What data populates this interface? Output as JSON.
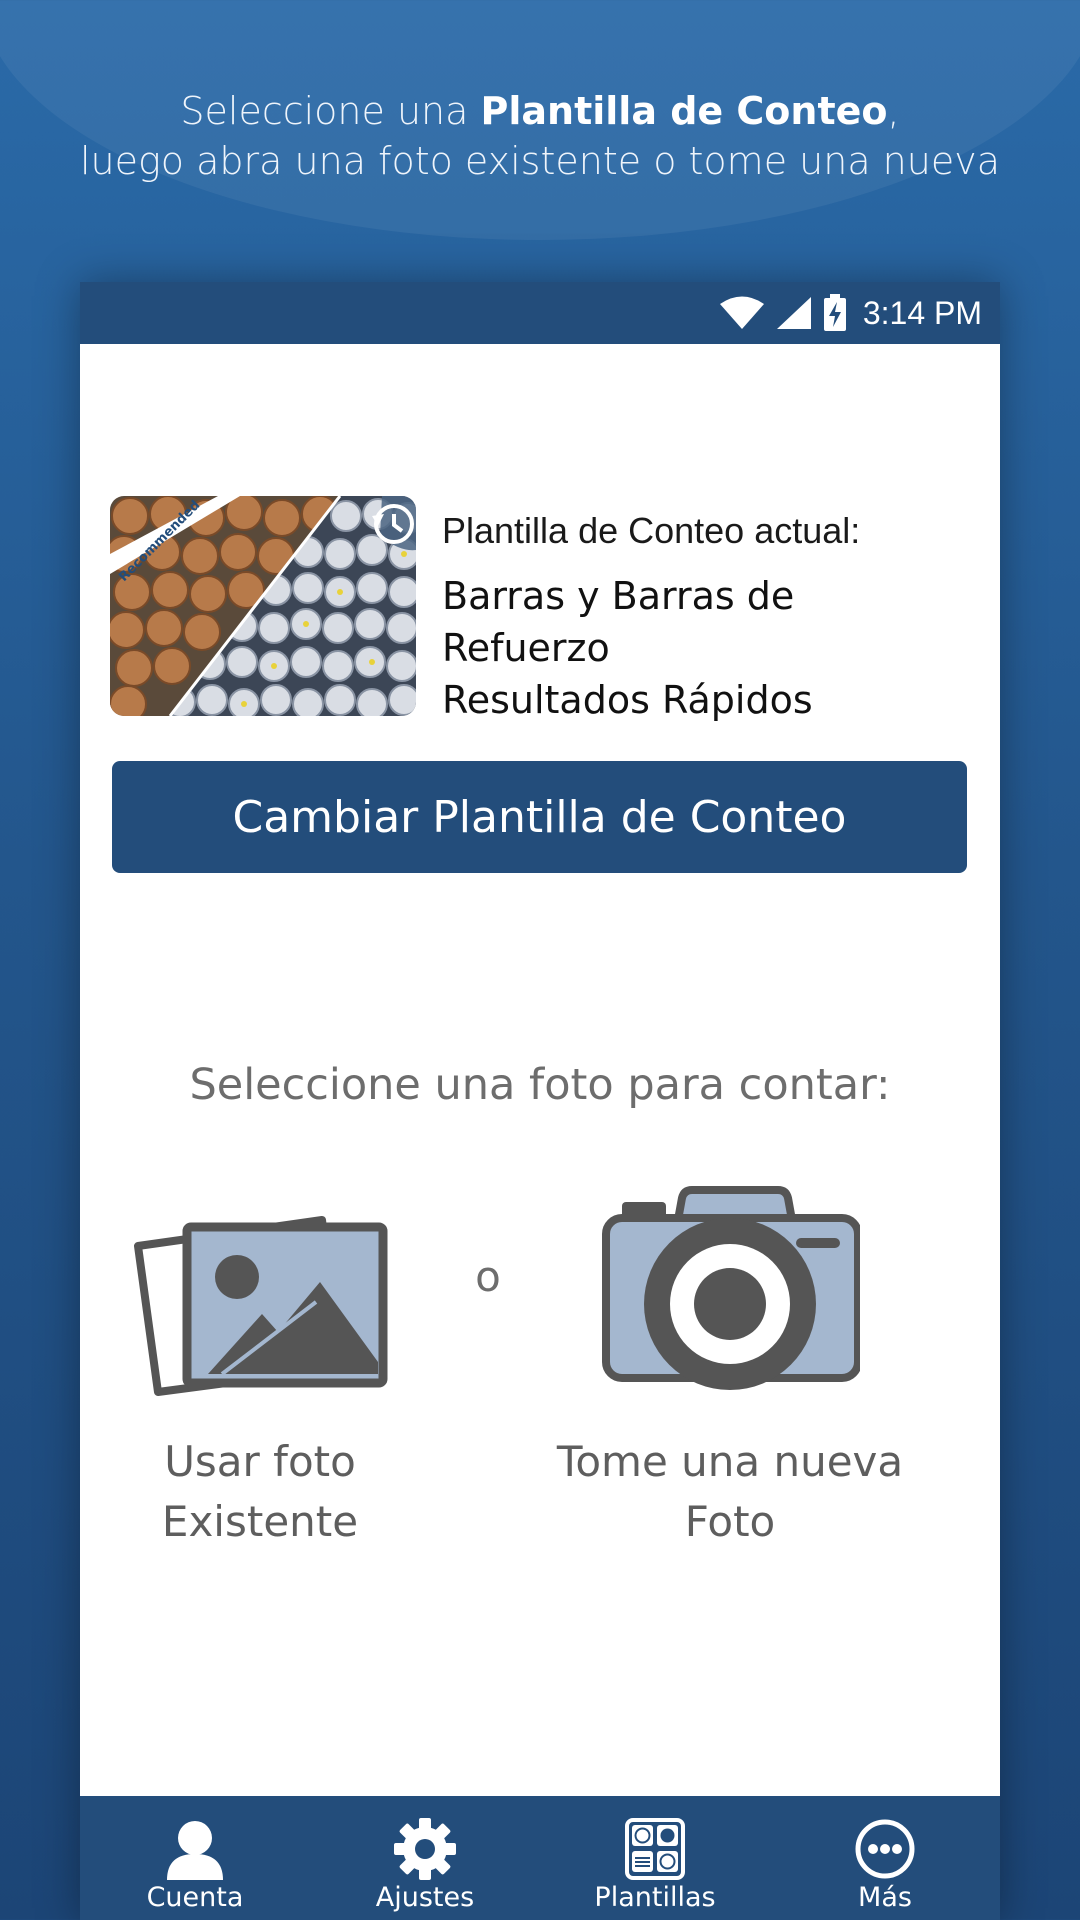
{
  "headline": {
    "prefix": "Seleccione una ",
    "bold": "Plantilla de Conteo",
    "suffix": ",",
    "line2": "luego abra una foto existente o tome una nueva"
  },
  "status_bar": {
    "time": "3:14 PM",
    "icons": [
      "wifi-icon",
      "signal-icon",
      "battery-charging-icon"
    ]
  },
  "template": {
    "badge": "Recommended",
    "heading": "Plantilla de Conteo actual:",
    "name_line1": "Barras y Barras de Refuerzo",
    "name_line2": "Resultados Rápidos"
  },
  "change_button": "Cambiar Plantilla de Conteo",
  "select_title": "Seleccione una foto para contar:",
  "options": {
    "existing_line1": "Usar foto",
    "existing_line2": "Existente",
    "or": "o",
    "new_line1": "Tome una nueva",
    "new_line2": "Foto"
  },
  "nav": {
    "items": [
      {
        "label": "Cuenta",
        "icon": "person-icon"
      },
      {
        "label": "Ajustes",
        "icon": "gear-icon"
      },
      {
        "label": "Plantillas",
        "icon": "templates-icon"
      },
      {
        "label": "Más",
        "icon": "more-icon"
      }
    ]
  },
  "colors": {
    "background": "#2a6aa8",
    "primary": "#234d7b",
    "icon_fill": "#a4b7cf",
    "icon_stroke": "#555555"
  }
}
